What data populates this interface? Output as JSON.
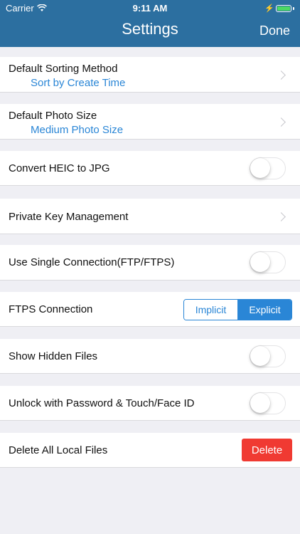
{
  "status_bar": {
    "carrier": "Carrier",
    "time": "9:11 AM"
  },
  "nav": {
    "title": "Settings",
    "done_label": "Done"
  },
  "settings": {
    "sorting": {
      "label": "Default Sorting Method",
      "value": "Sort by Create Time"
    },
    "photo_size": {
      "label": "Default Photo Size",
      "value": "Medium Photo Size"
    },
    "heic": {
      "label": "Convert HEIC to JPG",
      "on": false
    },
    "private_key": {
      "label": "Private Key Management"
    },
    "single_conn": {
      "label": "Use Single Connection(FTP/FTPS)",
      "on": false
    },
    "ftps": {
      "label": "FTPS Connection",
      "options": [
        "Implicit",
        "Explicit"
      ],
      "selected": "Explicit"
    },
    "hidden_files": {
      "label": "Show Hidden Files",
      "on": false
    },
    "unlock": {
      "label": "Unlock with Password & Touch/Face ID",
      "on": false
    },
    "delete_all": {
      "label": "Delete All Local Files",
      "button_label": "Delete"
    }
  },
  "colors": {
    "nav": "#2c6fa0",
    "accent": "#2a86d6",
    "destructive": "#f03a32",
    "background": "#efeff4"
  }
}
